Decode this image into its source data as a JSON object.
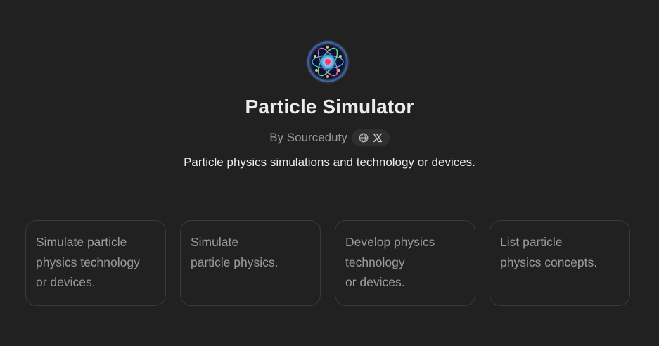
{
  "gpt": {
    "name": "Particle Simulator",
    "author_prefix": "By",
    "author": "Sourceduty",
    "byline": "By Sourceduty",
    "description": "Particle physics simulations and technology or devices."
  },
  "social_icons": [
    "globe-icon",
    "x-logo-icon"
  ],
  "conversation_starters": [
    "Simulate particle\nphysics technology\nor devices.",
    "Simulate\nparticle physics.",
    "Develop physics\ntechnology\nor devices.",
    "List particle\nphysics concepts."
  ],
  "colors": {
    "background": "#212121",
    "title": "#ececec",
    "muted_text": "#9b9b9b",
    "card_border": "#3a3a3a",
    "pill_background": "#2f2f2f"
  }
}
